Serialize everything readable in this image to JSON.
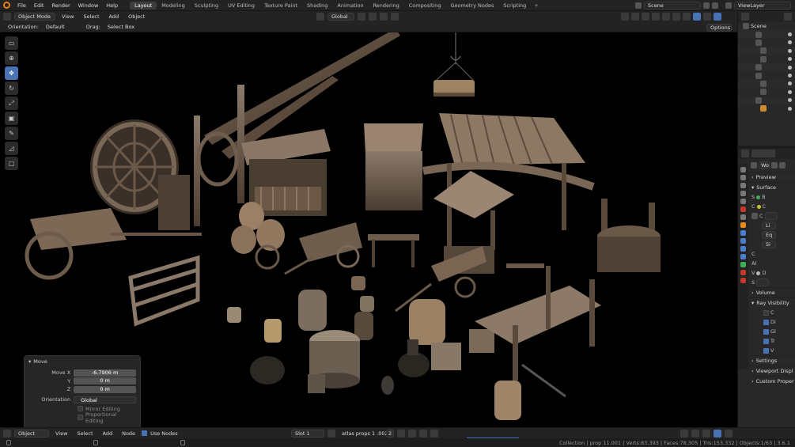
{
  "menu": [
    "File",
    "Edit",
    "Render",
    "Window",
    "Help"
  ],
  "workspaces": [
    "Layout",
    "Modeling",
    "Sculpting",
    "UV Editing",
    "Texture Paint",
    "Shading",
    "Animation",
    "Rendering",
    "Compositing",
    "Geometry Nodes",
    "Scripting"
  ],
  "active_workspace": "Layout",
  "scene": "Scene",
  "view_layer": "ViewLayer",
  "viewport_header": {
    "mode": "Object Mode",
    "menus": [
      "View",
      "Select",
      "Add",
      "Object"
    ],
    "transform_orientation": "Global"
  },
  "tool_settings": {
    "orientation_label": "Orientation:",
    "orientation_value": "Default",
    "drag_label": "Drag:",
    "drag_value": "Select Box",
    "options": "Options"
  },
  "operator_panel": {
    "title": "Move",
    "move_x_label": "Move X",
    "move_x": "-6.7906 m",
    "y_label": "Y",
    "y": "0 m",
    "z_label": "Z",
    "z": "0 m",
    "orientation_label": "Orientation",
    "orientation": "Global",
    "mirror_editing": "Mirror Editing",
    "proportional_editing": "Proportional Editing"
  },
  "outliner": {
    "root": "Scene"
  },
  "properties": {
    "world_name": "Wo",
    "sections": [
      "Preview",
      "Surface",
      "Volume",
      "Ray Visibility",
      "Settings",
      "Viewport Displ",
      "Custom Proper"
    ],
    "surface_rows": [
      "S",
      "C",
      "C",
      "Li",
      "Eq",
      "Si",
      "C",
      "Al",
      "V",
      "S"
    ],
    "surface_values": [
      "B",
      "C",
      "",
      "",
      "",
      "",
      "",
      "",
      "D",
      ""
    ],
    "ray_visibility": [
      "C",
      "Di",
      "Gl",
      "Tr",
      "V"
    ]
  },
  "node_editor_header": {
    "type": "Object",
    "menus": [
      "View",
      "Select",
      "Add",
      "Node"
    ],
    "use_nodes": "Use Nodes",
    "slot": "Slot 1",
    "material": "atlas props 1 .002",
    "users": "2"
  },
  "status_bar": "Collection | prop 11.001 | Verts:83,393 | Faces:78,305 | Tris:153,332 | Objects:1/63 | 3.6.1"
}
